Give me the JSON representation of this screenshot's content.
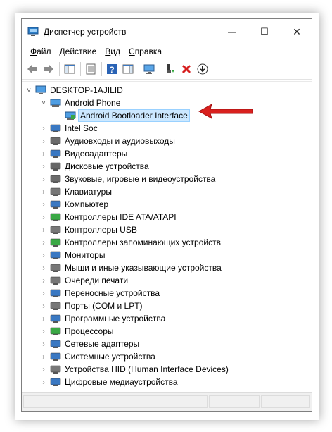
{
  "window": {
    "title": "Диспетчер устройств",
    "controls": {
      "minimize": "—",
      "maximize": "☐",
      "close": "✕"
    }
  },
  "menu": {
    "items": [
      {
        "first": "Ф",
        "rest": "айл"
      },
      {
        "first": "Д",
        "rest": "ействие"
      },
      {
        "first": "В",
        "rest": "ид"
      },
      {
        "first": "С",
        "rest": "правка"
      }
    ]
  },
  "tree": {
    "root": "DESKTOP-1AJILID",
    "android_phone": "Android Phone",
    "bootloader": "Android Bootloader Interface",
    "categories": [
      "Intel Soc",
      "Аудиовходы и аудиовыходы",
      "Видеоадаптеры",
      "Дисковые устройства",
      "Звуковые, игровые и видеоустройства",
      "Клавиатуры",
      "Компьютер",
      "Контроллеры IDE ATA/ATAPI",
      "Контроллеры USB",
      "Контроллеры запоминающих устройств",
      "Мониторы",
      "Мыши и иные указывающие устройства",
      "Очереди печати",
      "Переносные устройства",
      "Порты (COM и LPT)",
      "Программные устройства",
      "Процессоры",
      "Сетевые адаптеры",
      "Системные устройства",
      "Устройства HID (Human Interface Devices)",
      "Цифровые медиаустройства"
    ]
  },
  "colors": {
    "selection": "#cce8ff",
    "arrow": "#d9201e"
  }
}
